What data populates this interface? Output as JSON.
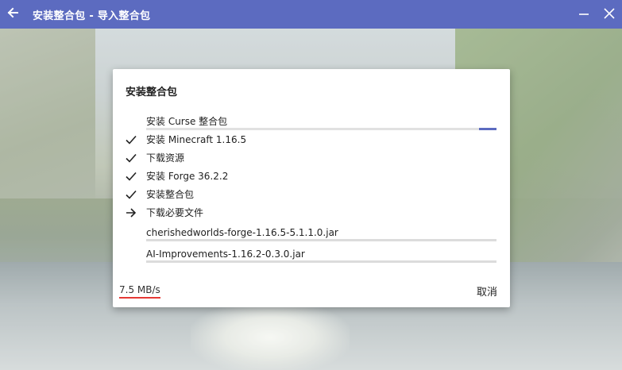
{
  "window": {
    "title": "安装整合包 - 导入整合包",
    "back_icon": "arrow-left-icon",
    "minimize_icon": "minimize-icon",
    "close_icon": "close-icon",
    "accent": "#5c6bc0"
  },
  "dialog": {
    "title": "安装整合包",
    "current_task": {
      "label": "安装 Curse 整合包",
      "progress": 0.05
    },
    "tasks": [
      {
        "label": "安装 Minecraft 1.16.5",
        "status": "done",
        "icon": "check-icon"
      },
      {
        "label": "下载资源",
        "status": "done",
        "icon": "check-icon"
      },
      {
        "label": "安装 Forge 36.2.2",
        "status": "done",
        "icon": "check-icon"
      },
      {
        "label": "安装整合包",
        "status": "done",
        "icon": "check-icon"
      },
      {
        "label": "下载必要文件",
        "status": "in-progress",
        "icon": "arrow-right-icon"
      }
    ],
    "downloads": [
      {
        "file": "cherishedworlds-forge-1.16.5-5.1.1.0.jar"
      },
      {
        "file": "AI-Improvements-1.16.2-0.3.0.jar"
      }
    ],
    "speed": "7.5 MB/s",
    "cancel_label": "取消"
  }
}
